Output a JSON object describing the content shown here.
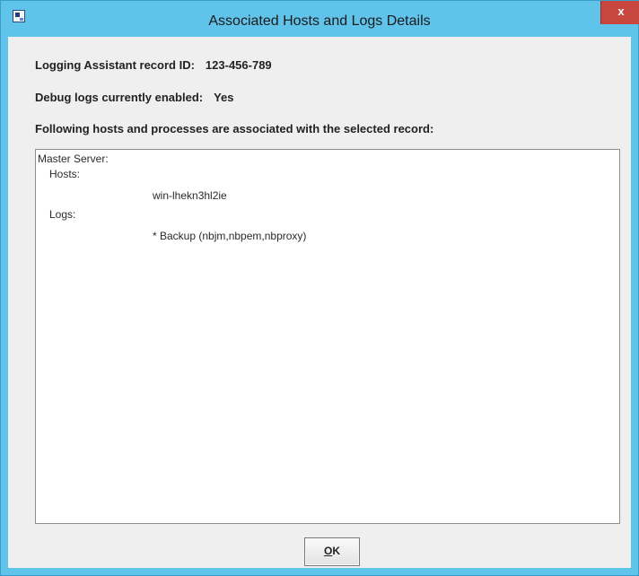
{
  "window": {
    "title": "Associated Hosts and Logs Details",
    "close_label": "x"
  },
  "info": {
    "record_id_label": "Logging Assistant record ID:",
    "record_id_value": "123-456-789",
    "debug_label": "Debug logs currently enabled:",
    "debug_value": "Yes",
    "following_text": "Following hosts and processes are associated with the selected record:"
  },
  "details": {
    "master_server_label": "Master Server:",
    "hosts_label": "Hosts:",
    "host_value": "win-lhekn3hl2ie",
    "logs_label": "Logs:",
    "log_value": "* Backup (nbjm,nbpem,nbproxy)"
  },
  "buttons": {
    "ok_mnemonic": "O",
    "ok_rest": "K"
  },
  "colors": {
    "titlebar": "#5fc3ea",
    "close": "#c7473f",
    "client_bg": "#efefef"
  }
}
